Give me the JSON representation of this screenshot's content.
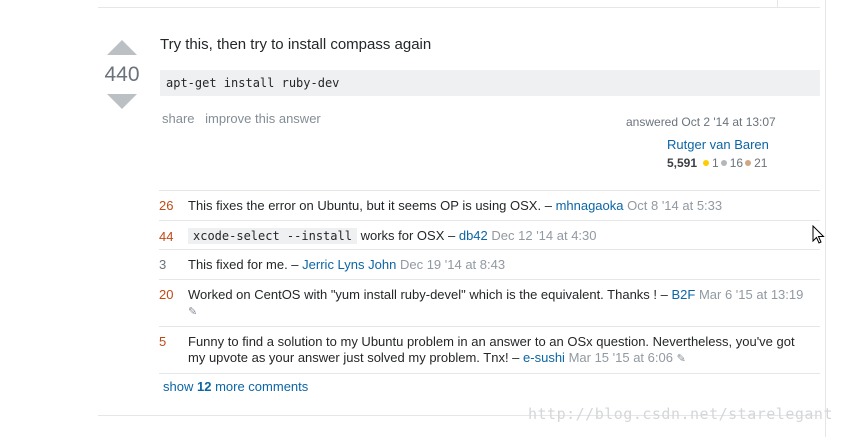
{
  "answer": {
    "vote_count": "440",
    "text": "Try this, then try to install compass again",
    "code": "apt-get install ruby-dev",
    "menu": {
      "share": "share",
      "improve": "improve this answer"
    },
    "answered": "answered Oct 2 '14 at 13:07",
    "user": {
      "name": "Rutger van Baren",
      "rep": "5,591",
      "gold": "1",
      "silver": "16",
      "bronze": "21"
    }
  },
  "comments": [
    {
      "score": "26",
      "text": "This fixes the error on Ubuntu, but it seems OP is using OSX. –",
      "user": "mhnagaoka",
      "date": "Oct 8 '14 at 5:33"
    },
    {
      "score": "44",
      "code": "xcode-select --install",
      "text": "works for OSX –",
      "user": "db42",
      "date": "Dec 12 '14 at 4:30"
    },
    {
      "score": "3",
      "text": "This fixed for me. –",
      "user": "Jerric Lyns John",
      "date": "Dec 19 '14 at 8:43"
    },
    {
      "score": "20",
      "text": "Worked on CentOS with \"yum install ruby-devel\" which is the equivalent. Thanks ! –",
      "user": "B2F",
      "date": "Mar 6 '15 at 13:19"
    },
    {
      "score": "5",
      "text": "Funny to find a solution to my Ubuntu problem in an answer to an OSx question. Nevertheless, you've got my upvote as your answer just solved my problem. Tnx! –",
      "user": "e-sushi",
      "date": "Mar 15 '15 at 6:06"
    }
  ],
  "show_more": {
    "prefix": "show",
    "count": "12",
    "suffix": "more comments"
  },
  "watermark": "http://blog.csdn.net/starelegant"
}
